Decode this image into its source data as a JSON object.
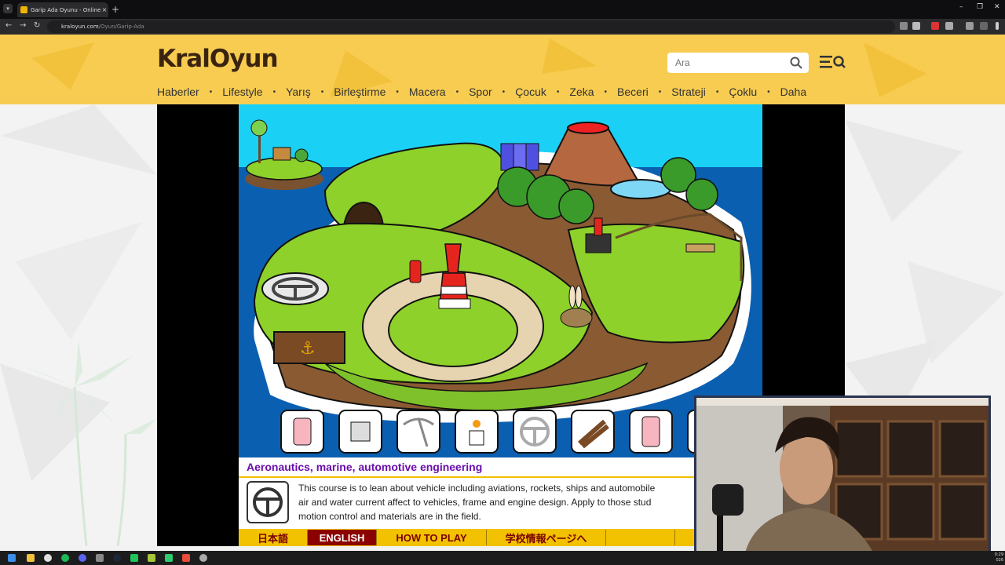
{
  "browser": {
    "tab_title": "Garip Ada Oyunu - Online ücre",
    "tab_close": "×",
    "new_tab": "+",
    "url_host": "kraloyun.com",
    "url_path": "/Oyun/Garip-Ada"
  },
  "site": {
    "logo_text": "KralOyun",
    "search_placeholder": "Ara",
    "nav": [
      "Haberler",
      "Lifestyle",
      "Yarış",
      "Birleştirme",
      "Macera",
      "Spor",
      "Çocuk",
      "Zeka",
      "Beceri",
      "Strateji",
      "Çoklu",
      "Daha"
    ]
  },
  "game": {
    "course_title": "Aeronautics, marine, automotive engineering",
    "description_lines": [
      "This course is to lean about vehicle including aviations, rockets, ships and automobile",
      "air and water current affect to vehicles, frame and engine design. Apply to those stud",
      "motion control and materials are in the field."
    ],
    "footer_buttons": [
      "日本語",
      "ENGLISH",
      "HOW TO PLAY",
      "学校情報ページへ",
      "",
      ""
    ],
    "active_language": "ENGLISH",
    "inventory": [
      "canister-item",
      "chip-item",
      "pickaxe-item",
      "burner-item",
      "wheel-item",
      "logs-item",
      "tube-item"
    ]
  },
  "taskbar": {
    "time": "0:29",
    "date": "026"
  },
  "colors": {
    "header": "#f7cc51",
    "sea": "#00aeef",
    "grass": "#8ed12a",
    "title_purple": "#6a0dad",
    "footer_yellow": "#f2c200",
    "active_red": "#8b0000"
  }
}
